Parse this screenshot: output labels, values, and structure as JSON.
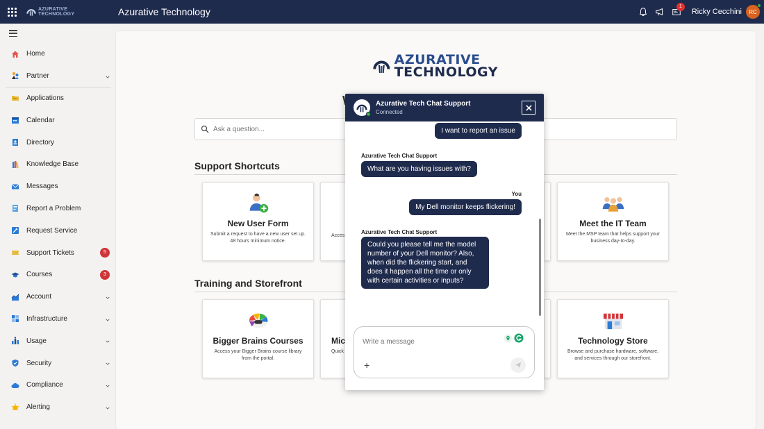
{
  "app": {
    "title": "Azurative Technology",
    "brand_line1": "AZURATIVE",
    "brand_line2": "TECHNOLOGY"
  },
  "topbar": {
    "icons": [
      "bell-icon",
      "megaphone-icon",
      "inbox-icon"
    ],
    "inbox_badge": "1",
    "user_name": "Ricky Cecchini",
    "user_initials": "RC"
  },
  "sidebar": {
    "items": [
      {
        "label": "Home",
        "icon": "home-icon"
      },
      {
        "label": "Partner",
        "icon": "partner-icon",
        "expandable": true
      },
      {
        "label": "Applications",
        "icon": "folder-icon"
      },
      {
        "label": "Calendar",
        "icon": "calendar-icon"
      },
      {
        "label": "Directory",
        "icon": "directory-icon"
      },
      {
        "label": "Knowledge Base",
        "icon": "book-icon"
      },
      {
        "label": "Messages",
        "icon": "mail-icon"
      },
      {
        "label": "Report a Problem",
        "icon": "report-icon"
      },
      {
        "label": "Request Service",
        "icon": "tools-icon"
      },
      {
        "label": "Support Tickets",
        "icon": "ticket-icon",
        "count": "5"
      },
      {
        "label": "Courses",
        "icon": "graduation-cap-icon",
        "count": "3"
      },
      {
        "label": "Account",
        "icon": "chart-icon",
        "expandable": true
      },
      {
        "label": "Infrastructure",
        "icon": "grid-icon",
        "expandable": true
      },
      {
        "label": "Usage",
        "icon": "people-icon",
        "expandable": true
      },
      {
        "label": "Security",
        "icon": "shield-icon",
        "expandable": true
      },
      {
        "label": "Compliance",
        "icon": "cloud-icon",
        "expandable": true
      },
      {
        "label": "Alerting",
        "icon": "alert-icon",
        "expandable": true
      }
    ]
  },
  "main": {
    "logo_line1": "AZURATIVE",
    "logo_line2": "TECHNOLOGY",
    "peek_heading": "W",
    "search_placeholder": "Ask a question...",
    "support_title": "Support Shortcuts",
    "training_title": "Training and Storefront",
    "support_tiles": [
      {
        "title": "New User Form",
        "desc": "Submit a request to have a new user set up. 48 hours minimum notice.",
        "icon": "add-user-icon"
      },
      {
        "title": "",
        "desc": "Acces",
        "icon": ""
      },
      {
        "title": "Meet the IT Team",
        "desc": "Meet the MSP team that helps support your business day-to-day.",
        "icon": "team-icon"
      }
    ],
    "training_tiles": [
      {
        "title": "Bigger Brains Courses",
        "desc": "Access your Bigger Brains course library from the portal.",
        "icon": "brain-icon"
      },
      {
        "title": "Mic",
        "desc": "Quick",
        "icon": ""
      },
      {
        "title": "Technology Store",
        "desc": "Browse and purchase hardware, software, and services through our storefront.",
        "icon": "store-icon"
      }
    ]
  },
  "chat": {
    "title": "Azurative Tech Chat Support",
    "status": "Connected",
    "messages": [
      {
        "sender": "",
        "text": "I want to report an issue",
        "side": "right"
      },
      {
        "sender": "Azurative Tech Chat Support",
        "text": "What are you having issues with?",
        "side": "left"
      },
      {
        "sender": "You",
        "text": "My Dell monitor keeps flickering!",
        "side": "right"
      },
      {
        "sender": "Azurative Tech Chat Support",
        "text": "Could you please tell me the model number of your Dell monitor? Also, when did the flickering start, and does it happen all the time or only with certain activities or inputs?",
        "side": "left"
      }
    ],
    "input_placeholder": "Write a message",
    "plus_label": "+"
  },
  "colors": {
    "navy": "#1f2b4d",
    "badge_red": "#d13438",
    "avatar_orange": "#d9621f"
  }
}
